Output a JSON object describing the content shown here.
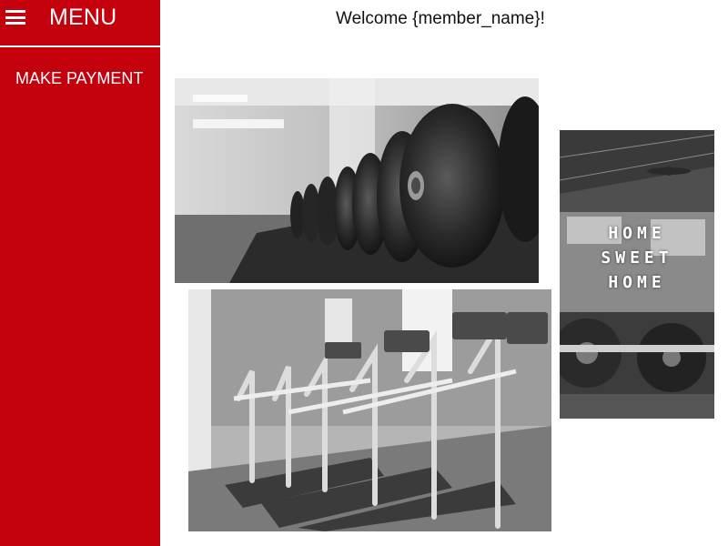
{
  "sidebar": {
    "menu_label": "MENU",
    "items": [
      {
        "label": "MAKE PAYMENT"
      }
    ]
  },
  "main": {
    "welcome": "Welcome {member_name}!"
  },
  "poster": {
    "lines": [
      "HOME",
      "SWEET",
      "HOME"
    ]
  },
  "colors": {
    "sidebar_bg": "#c4000d",
    "text_on_accent": "#ffffff"
  },
  "icons": [
    "menu-icon"
  ]
}
